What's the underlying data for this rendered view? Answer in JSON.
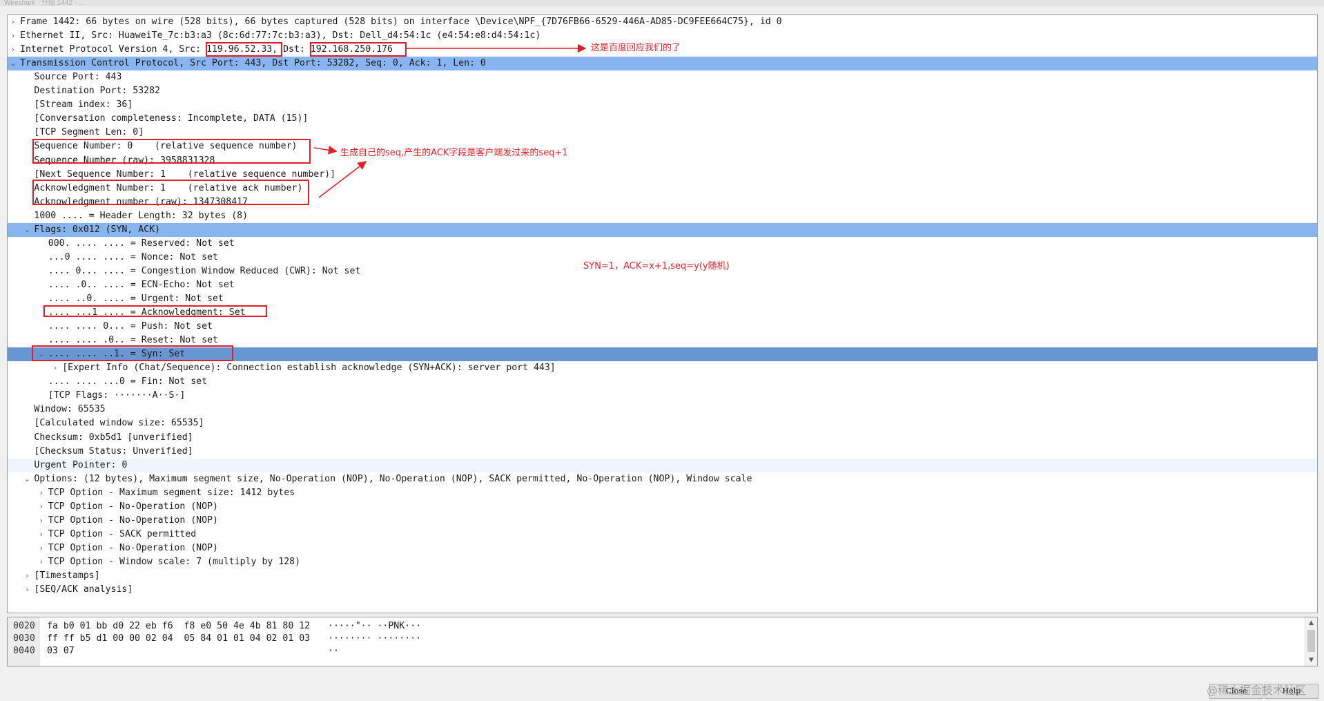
{
  "window": {
    "title": "Wireshark · 分组 1442 · ..."
  },
  "tree": [
    {
      "t": "Frame 1442: 66 bytes on wire (528 bits), 66 bytes captured (528 bits) on interface \\Device\\NPF_{7D76FB66-6529-446A-AD85-DC9FEE664C75}, id 0",
      "lvl": 0,
      "exp": "collapsed"
    },
    {
      "t": "Ethernet II, Src: HuaweiTe_7c:b3:a3 (8c:6d:77:7c:b3:a3), Dst: Dell_d4:54:1c (e4:54:e8:d4:54:1c)",
      "lvl": 0,
      "exp": "collapsed"
    },
    {
      "t": "Internet Protocol Version 4, Src: 119.96.52.33, Dst: 192.168.250.176",
      "lvl": 0,
      "exp": "collapsed"
    },
    {
      "t": "Transmission Control Protocol, Src Port: 443, Dst Port: 53282, Seq: 0, Ack: 1, Len: 0",
      "lvl": 0,
      "exp": "expanded",
      "sel": "sel"
    },
    {
      "t": "Source Port: 443",
      "lvl": 1
    },
    {
      "t": "Destination Port: 53282",
      "lvl": 1
    },
    {
      "t": "[Stream index: 36]",
      "lvl": 1
    },
    {
      "t": "[Conversation completeness: Incomplete, DATA (15)]",
      "lvl": 1
    },
    {
      "t": "[TCP Segment Len: 0]",
      "lvl": 1
    },
    {
      "t": "Sequence Number: 0    (relative sequence number)",
      "lvl": 1
    },
    {
      "t": "Sequence Number (raw): 3958831328",
      "lvl": 1
    },
    {
      "t": "[Next Sequence Number: 1    (relative sequence number)]",
      "lvl": 1
    },
    {
      "t": "Acknowledgment Number: 1    (relative ack number)",
      "lvl": 1
    },
    {
      "t": "Acknowledgment number (raw): 1347308417",
      "lvl": 1
    },
    {
      "t": "1000 .... = Header Length: 32 bytes (8)",
      "lvl": 1
    },
    {
      "t": "Flags: 0x012 (SYN, ACK)",
      "lvl": 1,
      "exp": "expanded",
      "sel": "sel"
    },
    {
      "t": "000. .... .... = Reserved: Not set",
      "lvl": 2
    },
    {
      "t": "...0 .... .... = Nonce: Not set",
      "lvl": 2
    },
    {
      "t": ".... 0... .... = Congestion Window Reduced (CWR): Not set",
      "lvl": 2
    },
    {
      "t": ".... .0.. .... = ECN-Echo: Not set",
      "lvl": 2
    },
    {
      "t": ".... ..0. .... = Urgent: Not set",
      "lvl": 2
    },
    {
      "t": ".... ...1 .... = Acknowledgment: Set",
      "lvl": 2
    },
    {
      "t": ".... .... 0... = Push: Not set",
      "lvl": 2
    },
    {
      "t": ".... .... .0.. = Reset: Not set",
      "lvl": 2
    },
    {
      "t": ".... .... ..1. = Syn: Set",
      "lvl": 2,
      "exp": "expanded",
      "sel": "sel2"
    },
    {
      "t": "[Expert Info (Chat/Sequence): Connection establish acknowledge (SYN+ACK): server port 443]",
      "lvl": 3,
      "exp": "collapsed"
    },
    {
      "t": ".... .... ...0 = Fin: Not set",
      "lvl": 2
    },
    {
      "t": "[TCP Flags: ·······A··S·]",
      "lvl": 2
    },
    {
      "t": "Window: 65535",
      "lvl": 1
    },
    {
      "t": "[Calculated window size: 65535]",
      "lvl": 1
    },
    {
      "t": "Checksum: 0xb5d1 [unverified]",
      "lvl": 1
    },
    {
      "t": "[Checksum Status: Unverified]",
      "lvl": 1
    },
    {
      "t": "Urgent Pointer: 0",
      "lvl": 1,
      "sel": "hover"
    },
    {
      "t": "Options: (12 bytes), Maximum segment size, No-Operation (NOP), No-Operation (NOP), SACK permitted, No-Operation (NOP), Window scale",
      "lvl": 1,
      "exp": "expanded"
    },
    {
      "t": "TCP Option - Maximum segment size: 1412 bytes",
      "lvl": 2,
      "exp": "collapsed"
    },
    {
      "t": "TCP Option - No-Operation (NOP)",
      "lvl": 2,
      "exp": "collapsed"
    },
    {
      "t": "TCP Option - No-Operation (NOP)",
      "lvl": 2,
      "exp": "collapsed"
    },
    {
      "t": "TCP Option - SACK permitted",
      "lvl": 2,
      "exp": "collapsed"
    },
    {
      "t": "TCP Option - No-Operation (NOP)",
      "lvl": 2,
      "exp": "collapsed"
    },
    {
      "t": "TCP Option - Window scale: 7 (multiply by 128)",
      "lvl": 2,
      "exp": "collapsed"
    },
    {
      "t": "[Timestamps]",
      "lvl": 1,
      "exp": "collapsed"
    },
    {
      "t": "[SEQ/ACK analysis]",
      "lvl": 1,
      "exp": "collapsed"
    }
  ],
  "glyphs": {
    "expanded": "⌄",
    "collapsed": "›"
  },
  "annotations": {
    "ip_src_box": "119.96.52.33",
    "ip_dst_box": "192.168.250.176",
    "note_baidu": "这是百度回应我们的了",
    "note_seq": "生成自己的seq,产生的ACK字段是客户端发过来的seq+1",
    "note_syn": "SYN=1，ACK=x+1,seq=y(y随机)",
    "color": "#e01e26"
  },
  "hex_dump": [
    {
      "offset": "0020",
      "hex": "fa b0 01 bb d0 22 eb f6  f8 e0 50 4e 4b 81 80 12",
      "ascii": "·····\"·· ··PNK···"
    },
    {
      "offset": "0030",
      "hex": "ff ff b5 d1 00 00 02 04  05 84 01 01 04 02 01 03",
      "ascii": "········ ········"
    },
    {
      "offset": "0040",
      "hex": "03 07",
      "ascii": "··"
    }
  ],
  "buttons": {
    "close": "Close",
    "help": "Help"
  },
  "watermark": "@稀土掘金技术社区",
  "colors": {
    "selection": "#88b4f0",
    "selection_active": "#6796d2",
    "hover": "#eef5fd"
  }
}
